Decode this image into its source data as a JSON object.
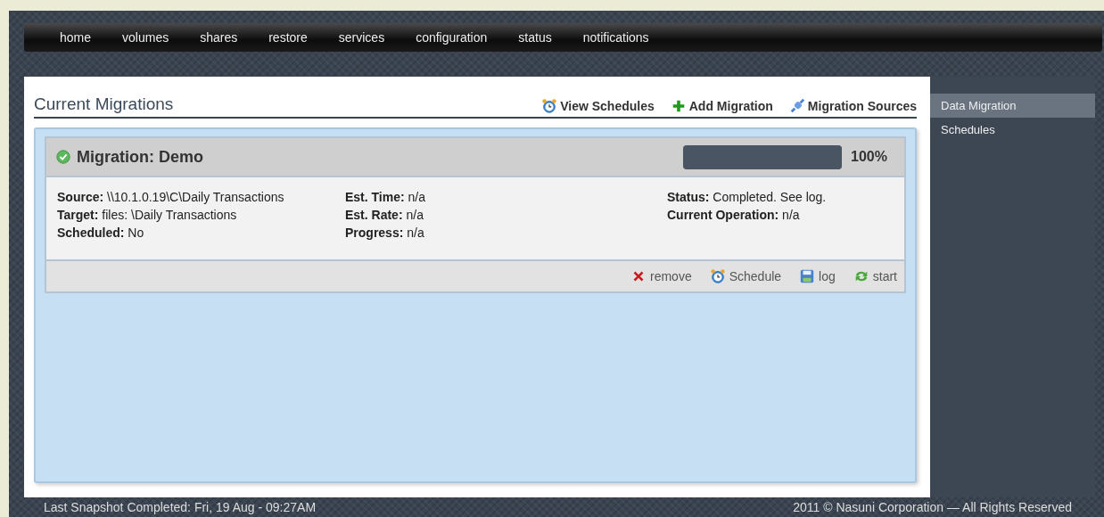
{
  "nav": [
    {
      "label": "home"
    },
    {
      "label": "volumes"
    },
    {
      "label": "shares"
    },
    {
      "label": "restore"
    },
    {
      "label": "services"
    },
    {
      "label": "configuration"
    },
    {
      "label": "status"
    },
    {
      "label": "notifications"
    }
  ],
  "page": {
    "title": "Current Migrations",
    "actions": [
      {
        "kind": "schedules",
        "label": "View Schedules"
      },
      {
        "kind": "add",
        "label": "Add Migration"
      },
      {
        "kind": "sources",
        "label": "Migration Sources"
      }
    ]
  },
  "migration": {
    "title": "Migration: Demo",
    "completed": true,
    "level": 1,
    "percent": "100%",
    "columns": [
      [
        "**Source:** \\\\10.1.0.19\\C\\Daily Transactions",
        "**Target:** files: \\Daily Transactions",
        "**Scheduled:** No"
      ],
      [
        "**Est. Time:** n/a",
        "**Est. Rate:** n/a",
        "**Progress:** n/a"
      ],
      [
        "**Status:** Completed. See log.",
        "**Current Operation:** n/a"
      ]
    ],
    "actions": [
      {
        "kind": "remove",
        "label": "remove"
      },
      {
        "kind": "schedule",
        "label": "Schedule"
      },
      {
        "kind": "log",
        "label": "log"
      },
      {
        "kind": "start",
        "label": "start"
      }
    ]
  },
  "sidebar": {
    "items": [
      {
        "label": "Data Migration",
        "selected": true
      },
      {
        "label": "Schedules",
        "selected": false
      }
    ]
  },
  "footer": {
    "left": "Last Snapshot Completed: Fri, 19 Aug - 09:27AM",
    "right": "2011 © Nasuni Corporation — All Rights Reserved"
  }
}
